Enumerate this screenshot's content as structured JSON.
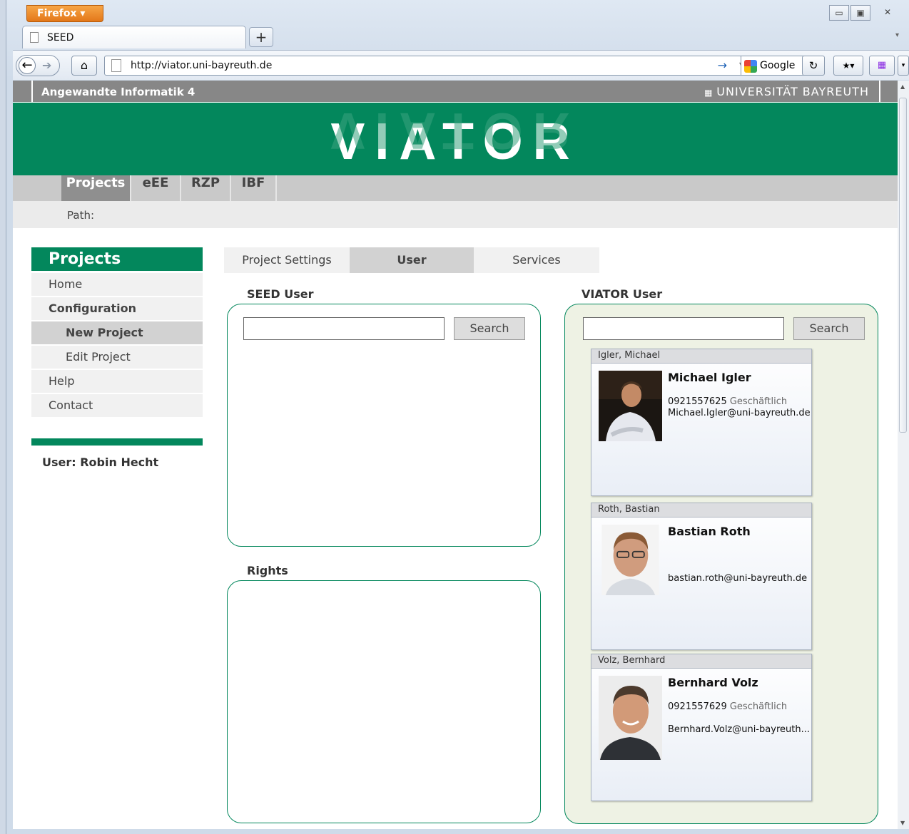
{
  "browser": {
    "menu_button": "Firefox",
    "tab_title": "SEED",
    "new_tab_symbol": "+",
    "url": "http://viator.uni-bayreuth.de",
    "search_engine": "Google"
  },
  "site": {
    "top_left": "Angewandte Informatik 4",
    "top_right": "UNIVERSITÄT BAYREUTH",
    "logo": "VIATOR",
    "nav": [
      "Projects",
      "eEE",
      "RZP",
      "IBF"
    ],
    "path_label": "Path:",
    "brand_color": "#03875c"
  },
  "sidebar": {
    "title": "Projects",
    "items": [
      "Home",
      "Configuration",
      "New Project",
      "Edit Project",
      "Help",
      "Contact"
    ],
    "user": "User: Robin Hecht"
  },
  "content": {
    "tabs": [
      "Project Settings",
      "User",
      "Services"
    ],
    "active_tab": "User",
    "seed_user_label": "SEED User",
    "viator_user_label": "VIATOR User",
    "rights_label": "Rights",
    "search_button": "Search",
    "users": [
      {
        "header": "Igler, Michael",
        "name": "Michael Igler",
        "phone": "0921557625",
        "phone_type": "Geschäftlich",
        "email": "Michael.Igler@uni-bayreuth.de"
      },
      {
        "header": "Roth, Bastian",
        "name": "Bastian Roth",
        "phone": "",
        "phone_type": "",
        "email": "bastian.roth@uni-bayreuth.de"
      },
      {
        "header": "Volz, Bernhard",
        "name": "Bernhard Volz",
        "phone": "0921557629",
        "phone_type": "Geschäftlich",
        "email": "Bernhard.Volz@uni-bayreuth..."
      }
    ]
  }
}
